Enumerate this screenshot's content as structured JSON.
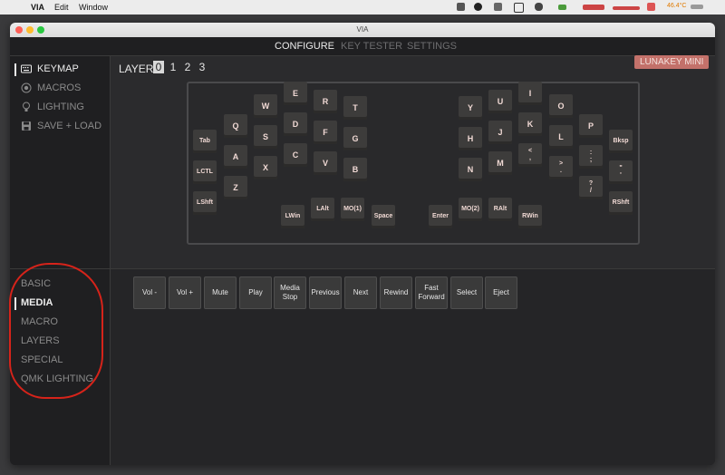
{
  "menubar": {
    "app": "VIA",
    "items": [
      "Edit",
      "Window"
    ],
    "temperature": "46.4°C"
  },
  "window": {
    "title": "VIA"
  },
  "tabs": [
    {
      "label": "CONFIGURE",
      "active": true
    },
    {
      "label": "KEY TESTER",
      "active": false
    },
    {
      "label": "SETTINGS",
      "active": false
    }
  ],
  "sidebar": {
    "items": [
      {
        "label": "KEYMAP",
        "icon": "keyboard-icon",
        "active": true
      },
      {
        "label": "MACROS",
        "icon": "record-icon",
        "active": false
      },
      {
        "label": "LIGHTING",
        "icon": "bulb-icon",
        "active": false
      },
      {
        "label": "SAVE + LOAD",
        "icon": "save-icon",
        "active": false
      }
    ]
  },
  "layers": {
    "label": "LAYER",
    "values": [
      "0",
      "1",
      "2",
      "3"
    ],
    "active": "0"
  },
  "keyboard_name": "LUNAKEY MINI",
  "keys": {
    "l_tab": "Tab",
    "l_q": "Q",
    "l_w": "W",
    "l_e": "E",
    "l_r": "R",
    "l_t": "T",
    "l_lctl": "LCTL",
    "l_a": "A",
    "l_s": "S",
    "l_d": "D",
    "l_f": "F",
    "l_g": "G",
    "l_lshft": "LShft",
    "l_z": "Z",
    "l_x": "X",
    "l_c": "C",
    "l_v": "V",
    "l_b": "B",
    "l_lwin": "LWin",
    "l_lalt": "LAlt",
    "l_mo1": "MO(1)",
    "l_space": "Space",
    "r_y": "Y",
    "r_u": "U",
    "r_i": "I",
    "r_o": "O",
    "r_p": "P",
    "r_bksp": "Bksp",
    "r_h": "H",
    "r_j": "J",
    "r_k": "K",
    "r_l": "L",
    "r_semi": ":\n;",
    "r_quote": "\"\n'",
    "r_n": "N",
    "r_m": "M",
    "r_comma": "<\n,",
    "r_dot": ">\n.",
    "r_slash": "?\n/",
    "r_rshft": "RShft",
    "r_enter": "Enter",
    "r_mo2": "MO(2)",
    "r_ralt": "RAlt",
    "r_rwin": "RWin"
  },
  "categories": [
    {
      "label": "BASIC",
      "active": false
    },
    {
      "label": "MEDIA",
      "active": true
    },
    {
      "label": "MACRO",
      "active": false
    },
    {
      "label": "LAYERS",
      "active": false
    },
    {
      "label": "SPECIAL",
      "active": false
    },
    {
      "label": "QMK LIGHTING",
      "active": false
    }
  ],
  "media_keys": [
    "Vol -",
    "Vol +",
    "Mute",
    "Play",
    "Media Stop",
    "Previous",
    "Next",
    "Rewind",
    "Fast Forward",
    "Select",
    "Eject"
  ],
  "colors": {
    "accent_badge": "#c3716a",
    "annotation": "#d6231a"
  }
}
